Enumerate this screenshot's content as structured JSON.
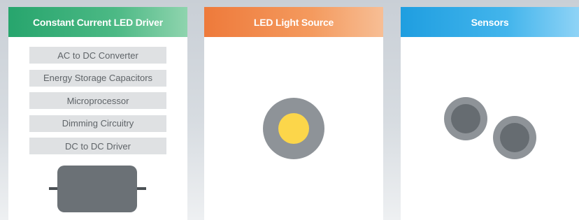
{
  "panels": [
    {
      "title": "Constant Current LED Driver",
      "header_color": "#2eaa72",
      "components": [
        "AC to DC Converter",
        "Energy Storage Capacitors",
        "Microprocessor",
        "Dimming Circuitry",
        "DC to DC Driver"
      ],
      "illustration": "led-driver-module"
    },
    {
      "title": "LED Light Source",
      "header_color": "#f0823f",
      "illustration": "led-light-source",
      "led_color": "#fcd64a"
    },
    {
      "title": "Sensors",
      "header_color": "#27a3e3",
      "illustration": "sensor-pair"
    }
  ]
}
